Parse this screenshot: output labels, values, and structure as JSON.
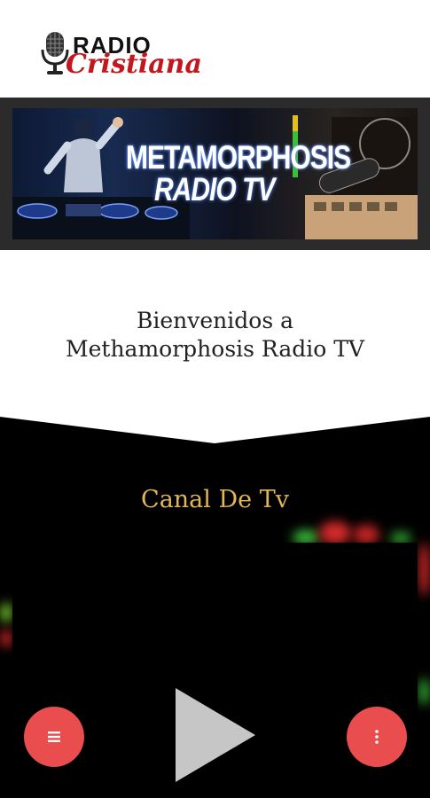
{
  "header": {
    "logo_word_top": "RADIO",
    "logo_word_bottom": "Cristiana"
  },
  "banner": {
    "title_line1": "METAMORPHOSIS",
    "title_line2": "RADIO TV"
  },
  "welcome": {
    "line1": "Bienvenidos a",
    "line2": "Methamorphosis Radio TV"
  },
  "section": {
    "title": "Canal De Tv"
  },
  "player": {
    "play_icon": "play-icon"
  },
  "fabs": {
    "menu_icon": "menu-icon",
    "more_icon": "more-vertical-icon",
    "color": "#ea4d4d"
  },
  "colors": {
    "accent_gold": "#e2b65a",
    "logo_red": "#c4171d"
  }
}
